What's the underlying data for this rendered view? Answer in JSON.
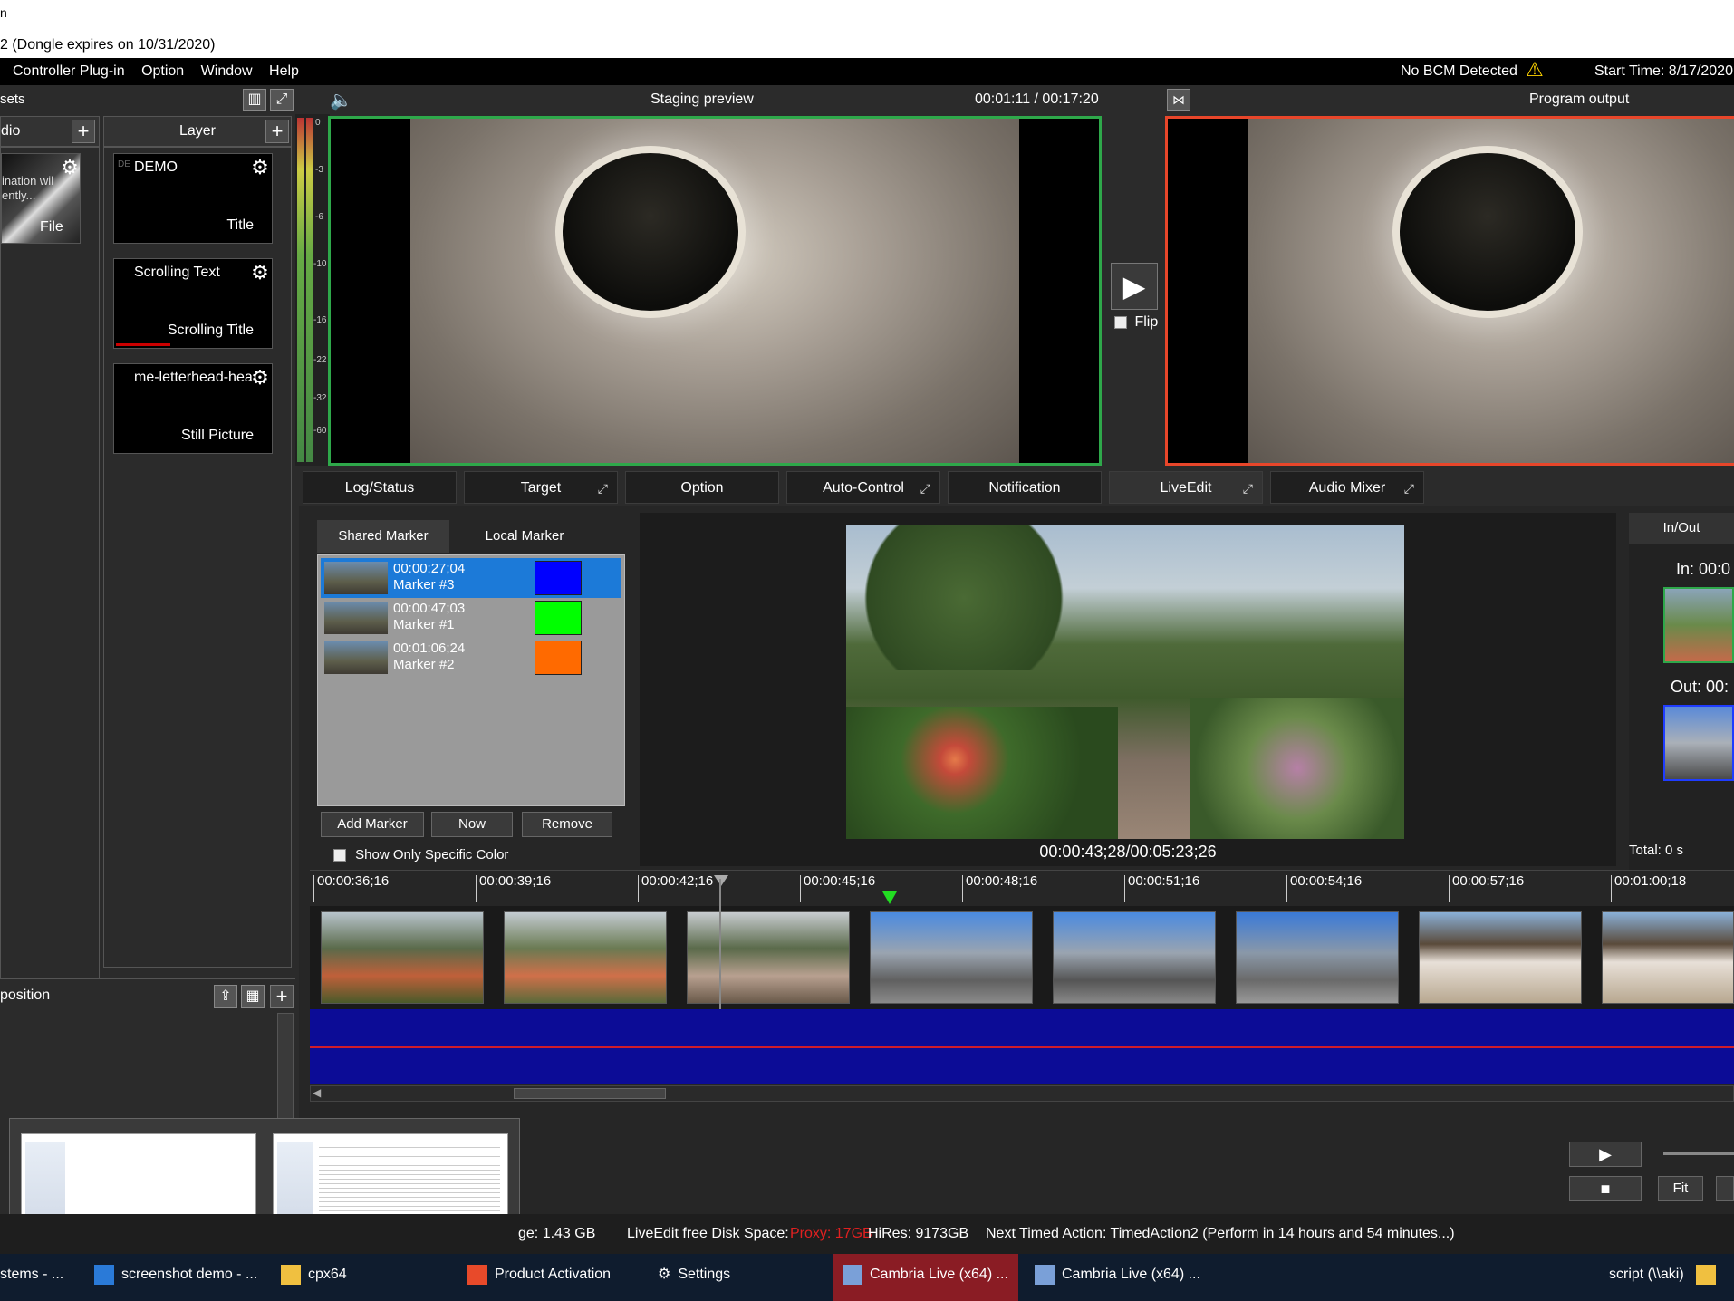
{
  "titlebar": {
    "text": "n"
  },
  "dongle_text": "2 (Dongle expires on 10/31/2020)",
  "menu": {
    "items": [
      "Controller Plug-in",
      "Option",
      "Window",
      "Help"
    ],
    "bcm_status": "No BCM Detected",
    "start_time": "Start Time: 8/17/2020"
  },
  "assets": {
    "header": "sets",
    "audio_col": "dio",
    "layer_col": "Layer",
    "audio_tile": {
      "text1": "ination wil",
      "text2": "ently...",
      "type": "File"
    },
    "layers": [
      {
        "name": "DEMO",
        "prefix": "DE",
        "type": "Title"
      },
      {
        "name": "Scrolling Text",
        "type": "Scrolling Title"
      },
      {
        "name": "me-letterhead-hea",
        "type": "Still Picture"
      }
    ]
  },
  "composition": {
    "header": "position"
  },
  "meter": {
    "ticks": [
      "0",
      "-3",
      "-6",
      "-10",
      "-16",
      "-22",
      "-32",
      "-60"
    ]
  },
  "staging": {
    "title": "Staging preview",
    "timecode": "00:01:11 / 00:17:20"
  },
  "program": {
    "title": "Program output"
  },
  "flip_label": "Flip",
  "tabs": [
    {
      "label": "Log/Status",
      "pin": false
    },
    {
      "label": "Target",
      "pin": true
    },
    {
      "label": "Option",
      "pin": false
    },
    {
      "label": "Auto-Control",
      "pin": true
    },
    {
      "label": "Notification",
      "pin": false
    },
    {
      "label": "LiveEdit",
      "pin": true
    },
    {
      "label": "Audio Mixer",
      "pin": true
    }
  ],
  "markers": {
    "tab_shared": "Shared Marker",
    "tab_local": "Local Marker",
    "rows": [
      {
        "time": "00:00:27;04",
        "name": "Marker #3",
        "color": "#0000ff"
      },
      {
        "time": "00:00:47;03",
        "name": "Marker #1",
        "color": "#00ff00"
      },
      {
        "time": "00:01:06;24",
        "name": "Marker #2",
        "color": "#ff6a00"
      }
    ],
    "add_label": "Add Marker",
    "now_label": "Now",
    "remove_label": "Remove",
    "filter_label": "Show Only Specific Color"
  },
  "liveedit": {
    "timecode": "00:00:43;28/00:05:23;26",
    "inout_title": "In/Out",
    "in_label": "In: 00:0",
    "out_label": "Out: 00:",
    "total_label": "Total: 0 s",
    "fit_label": "Fit"
  },
  "timeline": {
    "ticks": [
      "00:00:36;16",
      "00:00:39;16",
      "00:00:42;16",
      "00:00:45;16",
      "00:00:48;16",
      "00:00:51;16",
      "00:00:54;16",
      "00:00:57;16",
      "00:01:00;18"
    ]
  },
  "status": {
    "storage": "ge: 1.43 GB",
    "disk_label": "LiveEdit free Disk Space:",
    "proxy": "Proxy: 17GB",
    "hires": "HiRes: 9173GB",
    "next_action": "Next Timed Action:  TimedAction2 (Perform in 14 hours and 54 minutes...)"
  },
  "taskbar": {
    "items": [
      "stems - ...",
      "screenshot demo - ...",
      "cpx64",
      "Product Activation",
      "Settings",
      "Cambria Live (x64) ...",
      "Cambria Live (x64) ..."
    ],
    "right": "script (\\\\aki)"
  }
}
